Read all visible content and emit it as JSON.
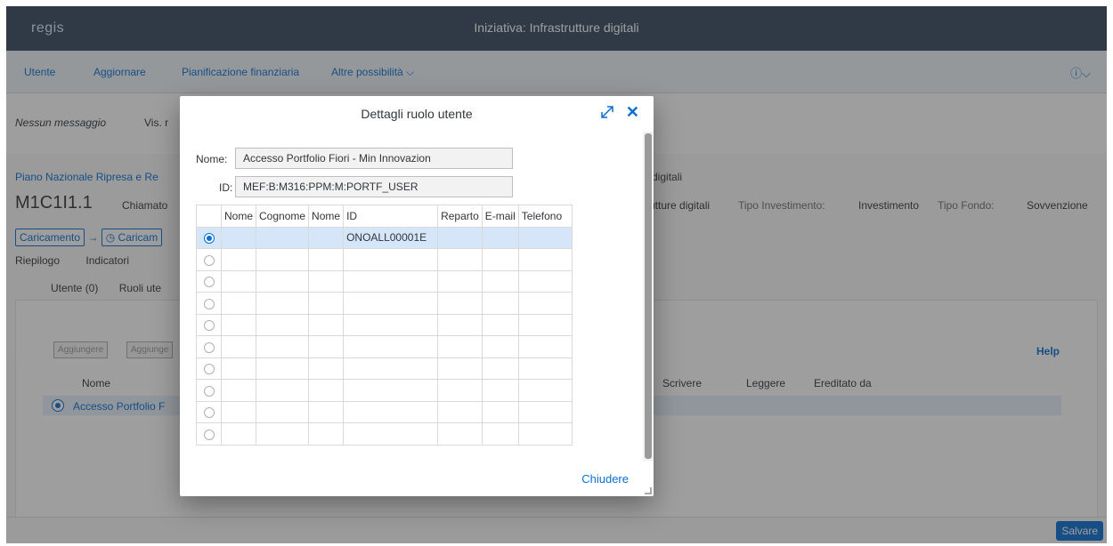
{
  "shell": {
    "logo": "regis",
    "title": "Iniziativa: Infrastrutture digitali"
  },
  "menu": {
    "items": [
      "Utente",
      "Aggiornare",
      "Pianificazione finanziaria",
      "Altre possibilità ⌵"
    ],
    "help": "ⓘ⌵"
  },
  "messages": {
    "none": "Nessun messaggio",
    "vis": "Vis. r"
  },
  "header": {
    "pnr": "Piano Nazionale Ripresa e Re",
    "digitali": "e digitali",
    "code": "M1C1I1.1",
    "chiamato": "Chiamato",
    "infra": "rutture digitali",
    "tipo_inv_label": "Tipo Investimento:",
    "tipo_inv_value": "Investimento",
    "tipo_fondo_label": "Tipo Fondo:",
    "tipo_fondo_value": "Sovvenzione",
    "btn_caricamento": "Caricamento",
    "btn_caricam": "Caricam"
  },
  "tabs": [
    "Riepilogo",
    "Indicatori"
  ],
  "subtabs": [
    "Utente (0)",
    "Ruoli ute"
  ],
  "content": {
    "btn_add1": "Aggiungere",
    "btn_add2": "Aggiunge",
    "help": "Help",
    "col_nome": "Nome",
    "col_scrivere": "Scrivere",
    "col_leggere": "Leggere",
    "col_ereditato": "Ereditato da",
    "row_name": "Accesso Portfolio F"
  },
  "footer": {
    "save": "Salvare"
  },
  "dialog": {
    "title": "Dettagli ruolo utente",
    "nome_label": "Nome:",
    "nome_value": "Accesso Portfolio Fiori - Min Innovazion",
    "id_label": "ID:",
    "id_value": "MEF:B:M316:PPM:M:PORTF_USER",
    "columns": [
      "Nome",
      "Cognome",
      "Nome",
      "ID",
      "Reparto",
      "E-mail",
      "Telefono"
    ],
    "rows": [
      [
        "",
        "",
        "",
        "ONOALL00001E",
        "",
        "",
        ""
      ],
      [
        "",
        "",
        "",
        "",
        "",
        "",
        ""
      ],
      [
        "",
        "",
        "",
        "",
        "",
        "",
        ""
      ],
      [
        "",
        "",
        "",
        "",
        "",
        "",
        ""
      ],
      [
        "",
        "",
        "",
        "",
        "",
        "",
        ""
      ],
      [
        "",
        "",
        "",
        "",
        "",
        "",
        ""
      ],
      [
        "",
        "",
        "",
        "",
        "",
        "",
        ""
      ],
      [
        "",
        "",
        "",
        "",
        "",
        "",
        ""
      ],
      [
        "",
        "",
        "",
        "",
        "",
        "",
        ""
      ],
      [
        "",
        "",
        "",
        "",
        "",
        "",
        ""
      ]
    ],
    "selected_row": 0,
    "close_label": "Chiudere",
    "close_icon": "✕"
  }
}
